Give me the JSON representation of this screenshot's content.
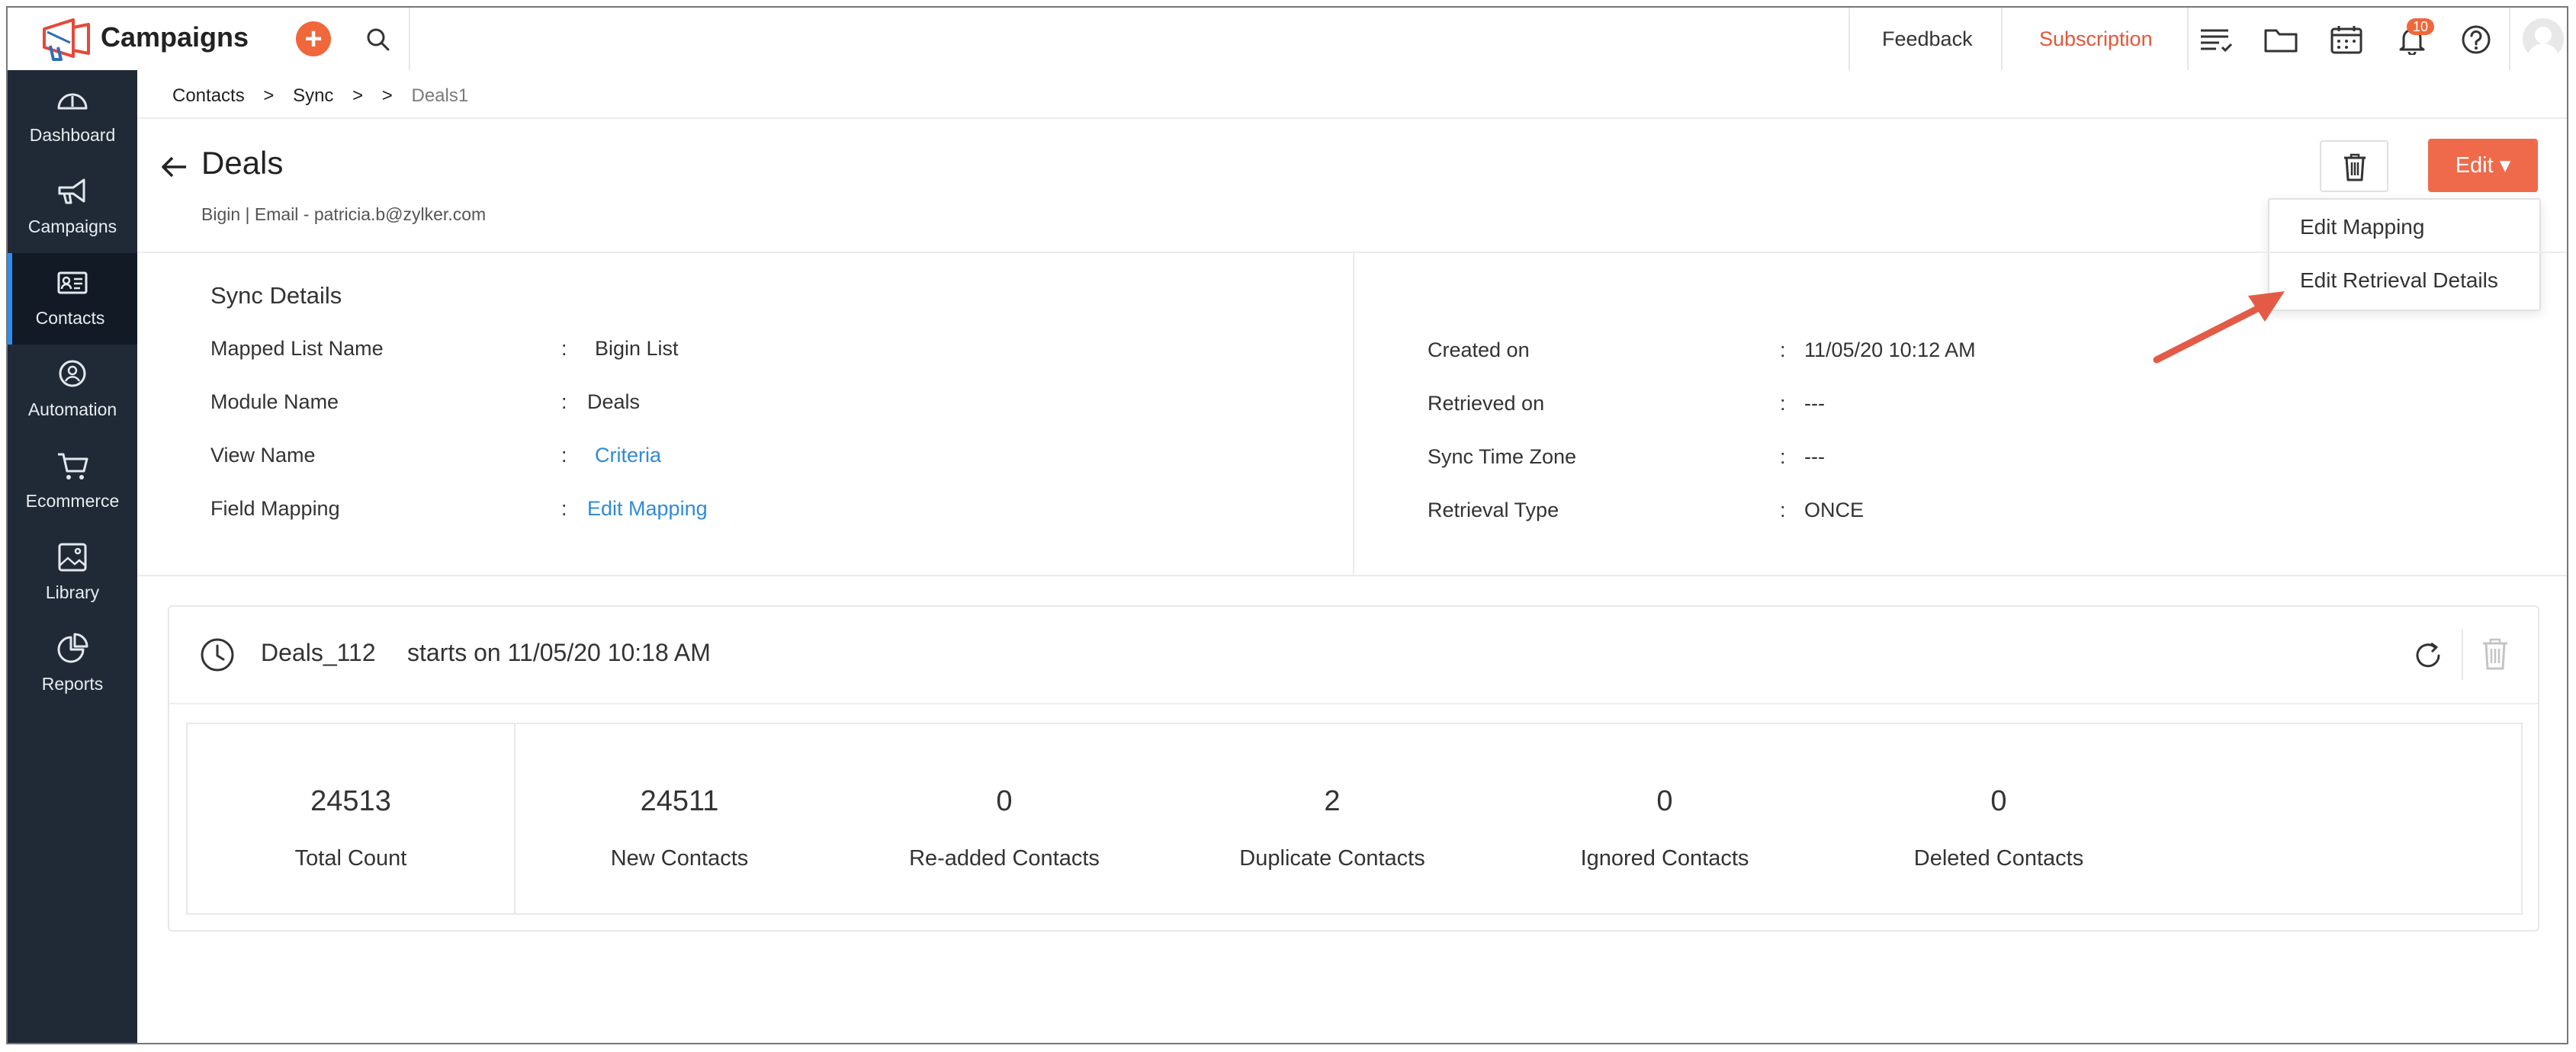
{
  "topbar": {
    "brand": "Campaigns",
    "plus": "+",
    "feedback": "Feedback",
    "subscription": "Subscription",
    "notification_count": "10"
  },
  "sidebar": {
    "items": [
      {
        "label": "Dashboard",
        "icon": "gauge-icon"
      },
      {
        "label": "Campaigns",
        "icon": "megaphone-icon"
      },
      {
        "label": "Contacts",
        "icon": "contact-card-icon",
        "active": true
      },
      {
        "label": "Automation",
        "icon": "automation-icon"
      },
      {
        "label": "Ecommerce",
        "icon": "cart-icon"
      },
      {
        "label": "Library",
        "icon": "image-library-icon"
      },
      {
        "label": "Reports",
        "icon": "pie-chart-icon"
      }
    ]
  },
  "breadcrumb": {
    "items": [
      "Contacts",
      "Sync",
      "Deals1"
    ],
    "sep": ">"
  },
  "header": {
    "title": "Deals",
    "subtitle": "Bigin | Email - patricia.b@zylker.com",
    "edit_label": "Edit ▾"
  },
  "dropdown": {
    "items": [
      "Edit Mapping",
      "Edit Retrieval Details"
    ]
  },
  "sync_details": {
    "title": "Sync Details",
    "left": [
      {
        "label": "Mapped List Name",
        "value": "Bigin List",
        "link": false
      },
      {
        "label": "Module Name",
        "value": "Deals",
        "link": false
      },
      {
        "label": "View Name",
        "value": "Criteria",
        "link": true
      },
      {
        "label": "Field Mapping",
        "value": "Edit Mapping",
        "link": true
      }
    ],
    "right": [
      {
        "label": "Created on",
        "value": "11/05/20 10:12 AM"
      },
      {
        "label": "Retrieved on",
        "value": "---"
      },
      {
        "label": "Sync Time Zone",
        "value": "---"
      },
      {
        "label": "Retrieval Type",
        "value": "ONCE"
      }
    ],
    "colon": ":"
  },
  "schedule": {
    "name": "Deals_112",
    "starts": "starts on 11/05/20 10:18 AM",
    "stats": [
      {
        "value": "24513",
        "label": "Total Count"
      },
      {
        "value": "24511",
        "label": "New Contacts"
      },
      {
        "value": "0",
        "label": "Re-added Contacts"
      },
      {
        "value": "2",
        "label": "Duplicate Contacts"
      },
      {
        "value": "0",
        "label": "Ignored Contacts"
      },
      {
        "value": "0",
        "label": "Deleted Contacts"
      }
    ]
  },
  "colors": {
    "accent": "#ef6a4a",
    "sidebar": "#1f2a36",
    "link": "#2f8bd8",
    "active_indicator": "#2d8ef0"
  }
}
